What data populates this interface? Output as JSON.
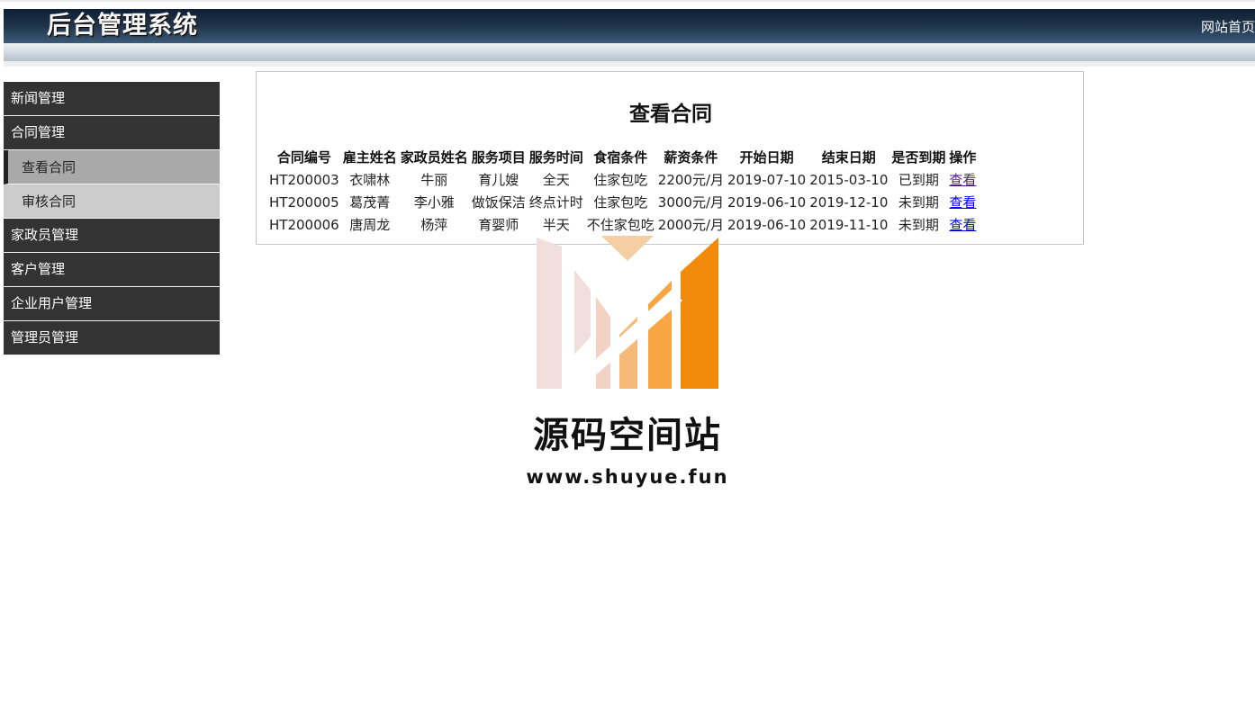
{
  "header": {
    "title": "后台管理系统",
    "home_link": "网站首页"
  },
  "sidebar": {
    "groups": [
      {
        "label": "新闻管理"
      },
      {
        "label": "合同管理",
        "children": [
          {
            "label": "查看合同",
            "active": true
          },
          {
            "label": "审核合同",
            "active": false
          }
        ]
      },
      {
        "label": "家政员管理"
      },
      {
        "label": "客户管理"
      },
      {
        "label": "企业用户管理"
      },
      {
        "label": "管理员管理"
      }
    ]
  },
  "main": {
    "heading": "查看合同",
    "table": {
      "columns": [
        "合同编号",
        "雇主姓名",
        "家政员姓名",
        "服务项目",
        "服务时间",
        "食宿条件",
        "薪资条件",
        "开始日期",
        "结束日期",
        "是否到期",
        "操作"
      ],
      "rows": [
        [
          "HT200003",
          "衣啸林",
          "牛丽",
          "育儿嫂",
          "全天",
          "住家包吃",
          "2200元/月",
          "2019-07-10",
          "2015-03-10",
          "已到期",
          "查看"
        ],
        [
          "HT200005",
          "葛茂菁",
          "李小雅",
          "做饭保洁",
          "终点计时",
          "住家包吃",
          "3000元/月",
          "2019-06-10",
          "2019-12-10",
          "未到期",
          "查看"
        ],
        [
          "HT200006",
          "唐周龙",
          "杨萍",
          "育婴师",
          "半天",
          "不住家包吃",
          "2000元/月",
          "2019-06-10",
          "2019-11-10",
          "未到期",
          "查看"
        ]
      ]
    }
  },
  "watermark": {
    "name": "源码空间站",
    "url": "www.shuyue.fun"
  },
  "colors": {
    "header_dark": "#1d3147",
    "sidebar_bg": "#333333",
    "sub_active_bg": "#a9a9a9",
    "sub_bg": "#cccccc",
    "link": "#0000ee",
    "link_visited": "#551a8b",
    "logo_orange": "#f28a0c"
  }
}
